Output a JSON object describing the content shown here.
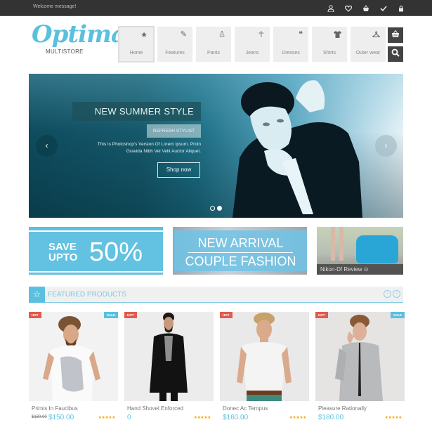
{
  "topbar": {
    "welcome": "Welcome message!",
    "icons": [
      "account-icon",
      "wishlist-heart-icon",
      "cart-basket-icon",
      "checkout-check-icon",
      "login-lock-icon"
    ]
  },
  "logo": {
    "brand": "Optima",
    "tagline": "MULTISTORE"
  },
  "nav": {
    "items": [
      {
        "label": "Home",
        "icon": "star-icon",
        "active": true
      },
      {
        "label": "Features",
        "icon": "pencil-icon"
      },
      {
        "label": "Pants",
        "icon": "person-bag-icon"
      },
      {
        "label": "Jeans",
        "icon": "person-standing-icon"
      },
      {
        "label": "Dresses",
        "icon": "footprints-icon"
      },
      {
        "label": "Shirts",
        "icon": "tshirt-icon"
      },
      {
        "label": "Outer wear",
        "icon": "hanger-icon"
      }
    ],
    "cart_icon": "basket-icon",
    "search_icon": "search-icon"
  },
  "hero": {
    "title": "NEW SUMMER STYLE",
    "button_refresh": "REFRESH STYLIST",
    "description_line1": "This Is Photoshop's Version Of Lorem Ipsum. Proin",
    "description_line2": "Gravida Nibh Vel Velit Auctor Aliquet.",
    "button_shop": "Shop now",
    "prev": "‹",
    "next": "›",
    "slides_total": 2,
    "slide_active": 2
  },
  "banners": {
    "save_line1": "SAVE",
    "save_line2": "UPTO",
    "save_pct": "50%",
    "arrival_line1": "NEW ARRIVAL",
    "arrival_line2": "COUPLE FASHION",
    "review_caption": "Nikon-Df Review ⊙"
  },
  "featured": {
    "title": "FEATURED PRODUCTS",
    "star": "☆",
    "prev": "‹",
    "next": "›",
    "products": [
      {
        "name": "Primis In Faucibus",
        "old_price": "$180.00",
        "price": "$150.00",
        "hot": "HOT",
        "sale": "SALE",
        "rating": 5,
        "stars": "★★★★★"
      },
      {
        "name": "Hand Shovel Enforced",
        "old_price": "",
        "price": "0",
        "hot": "HOT",
        "sale": "",
        "rating": 5,
        "stars": "★★★★★"
      },
      {
        "name": "Donec Ac Tempus",
        "old_price": "",
        "price": "$160.00",
        "hot": "HOT",
        "sale": "",
        "rating": 5,
        "stars": "★★★★★"
      },
      {
        "name": "Pleasure Rationally",
        "old_price": "",
        "price": "$180.00",
        "hot": "HOT",
        "sale": "SALE",
        "rating": 5,
        "stars": "★★★★★"
      }
    ]
  },
  "colors": {
    "accent": "#5bc0de",
    "topbar": "#333333",
    "hot": "#e05a4e",
    "stars": "#f7a600"
  }
}
